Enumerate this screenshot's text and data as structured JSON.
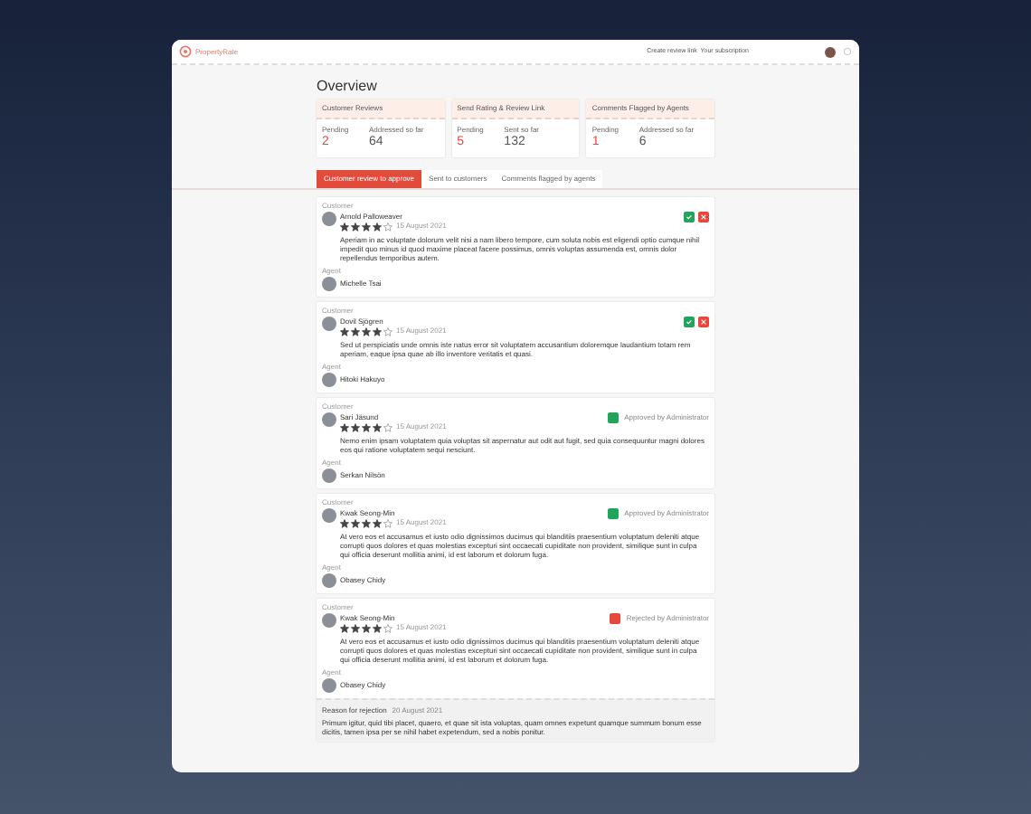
{
  "header": {
    "logo": "PropertyRate",
    "nav": "Create review link  Your subscription"
  },
  "overview": {
    "title": "Overview",
    "cards": [
      {
        "title": "Customer Reviews",
        "stats": [
          {
            "label": "Pending",
            "value": "2",
            "kind": "pending"
          },
          {
            "label": "Addressed so far",
            "value": "64",
            "kind": "total"
          }
        ]
      },
      {
        "title": "Send Rating & Review Link",
        "stats": [
          {
            "label": "Pending",
            "value": "5",
            "kind": "pending"
          },
          {
            "label": "Sent so far",
            "value": "132",
            "kind": "total"
          }
        ]
      },
      {
        "title": "Comments Flagged by Agents",
        "stats": [
          {
            "label": "Pending",
            "value": "1",
            "kind": "pending"
          },
          {
            "label": "Addressed so far",
            "value": "6",
            "kind": "total"
          }
        ]
      }
    ]
  },
  "tabs": [
    {
      "label": "Customer review to approve",
      "selected": true
    },
    {
      "label": "Sent to customers",
      "selected": false
    },
    {
      "label": "Comments flagged by agents",
      "selected": false
    }
  ],
  "reviews": [
    {
      "author_label": "Customer",
      "author": "Arnold Palloweaver",
      "stars": 4,
      "date": "15 August 2021",
      "text": "Aperiam in ac voluptate dolorum velit nisi a nam libero tempore, cum soluta nobis est eligendi optio cumque nihil impedit quo minus id quod maxime placeat facere possimus, omnis voluptas assumenda est, omnis dolor repellendus temporibus autem.",
      "agent_label": "Agent",
      "agent": "Michelle Tsai",
      "status": {
        "kind": "actions"
      }
    },
    {
      "author_label": "Customer",
      "author": "Dovil Sjögren",
      "stars": 4,
      "date": "15 August 2021",
      "text": "Sed ut perspiciatis unde omnis iste natus error sit voluptatem accusantium doloremque laudantium totam rem aperiam, eaque ipsa quae ab illo inventore veritatis et quasi.",
      "agent_label": "Agent",
      "agent": "Hitoki Hakuyo",
      "status": {
        "kind": "actions"
      }
    },
    {
      "author_label": "Customer",
      "author": "Sari Jäsund",
      "stars": 4,
      "date": "15 August 2021",
      "text": "Nemo enim ipsam voluptatem quia voluptas sit aspernatur aut odit aut fugit, sed quia consequuntur magni dolores eos qui ratione voluptatem sequi nesciunt.",
      "agent_label": "Agent",
      "agent": "Serkan Nilsön",
      "status": {
        "kind": "approved",
        "label": "Approved by Administrator"
      }
    },
    {
      "author_label": "Customer",
      "author": "Kwak Seong-Min",
      "stars": 4,
      "date": "15 August 2021",
      "text": "At vero eos et accusamus et iusto odio dignissimos ducimus qui blanditiis praesentium voluptatum deleniti atque corrupti quos dolores et quas molestias excepturi sint occaecati cupiditate non provident, similique sunt in culpa qui officia deserunt mollitia animi, id est laborum et dolorum fuga.",
      "agent_label": "Agent",
      "agent": "Obasey Chidy",
      "status": {
        "kind": "approved",
        "label": "Approved by Administrator"
      }
    },
    {
      "author_label": "Customer",
      "author": "Kwak Seong-Min",
      "stars": 4,
      "date": "15 August 2021",
      "text": "At vero eos et accusamus et iusto odio dignissimos ducimus qui blanditiis praesentium voluptatum deleniti atque corrupti quos dolores et quas molestias excepturi sint occaecati cupiditate non provident, similique sunt in culpa qui officia deserunt mollitia animi, id est laborum et dolorum fuga.",
      "agent_label": "Agent",
      "agent": "Obasey Chidy",
      "status": {
        "kind": "rejected",
        "label": "Rejected by Administrator"
      },
      "rejection": {
        "label": "Reason for rejection",
        "date": "20 August 2021",
        "text": "Primum igitur, quid tibi placet, quaero, et quae sit ista voluptas, quam omnes expetunt quamque summum bonum esse dicitis, tamen ipsa per se nihil habet expetendum, sed a nobis ponitur."
      }
    }
  ]
}
